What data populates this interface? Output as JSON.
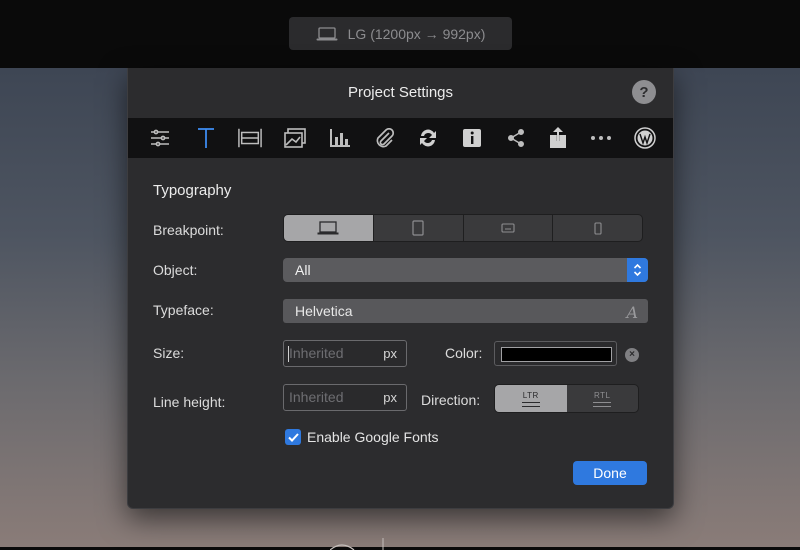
{
  "topbar": {
    "breakpoint_label": "LG (1200px → 992px)"
  },
  "dialog": {
    "title": "Project Settings",
    "help_label": "?",
    "toolbar": [
      {
        "name": "sliders-icon"
      },
      {
        "name": "typography-icon",
        "active": true
      },
      {
        "name": "width-icon"
      },
      {
        "name": "image-icon"
      },
      {
        "name": "chart-icon"
      },
      {
        "name": "paperclip-icon"
      },
      {
        "name": "sync-icon"
      },
      {
        "name": "info-icon"
      },
      {
        "name": "share-icon"
      },
      {
        "name": "export-icon"
      },
      {
        "name": "more-icon"
      },
      {
        "name": "wordpress-icon"
      }
    ],
    "section_title": "Typography",
    "breakpoint": {
      "label": "Breakpoint:",
      "options": [
        "laptop-icon",
        "tablet-icon",
        "tablet-landscape-icon",
        "phone-icon"
      ],
      "selected": 0
    },
    "object": {
      "label": "Object:",
      "value": "All"
    },
    "typeface": {
      "label": "Typeface:",
      "value": "Helvetica",
      "icon": "A"
    },
    "size": {
      "label": "Size:",
      "placeholder": "Inherited",
      "unit": "px"
    },
    "color": {
      "label": "Color:",
      "value": "#000000",
      "clear_icon": "×"
    },
    "line_height": {
      "label": "Line height:",
      "placeholder": "Inherited",
      "unit": "px"
    },
    "direction": {
      "label": "Direction:",
      "options": [
        "LTR",
        "RTL"
      ],
      "selected": "LTR"
    },
    "google_fonts": {
      "label": "Enable Google Fonts",
      "checked": true
    },
    "done_label": "Done"
  },
  "colors": {
    "accent": "#2f79df",
    "panel": "#2c2c2e",
    "toolbar": "#111112"
  }
}
